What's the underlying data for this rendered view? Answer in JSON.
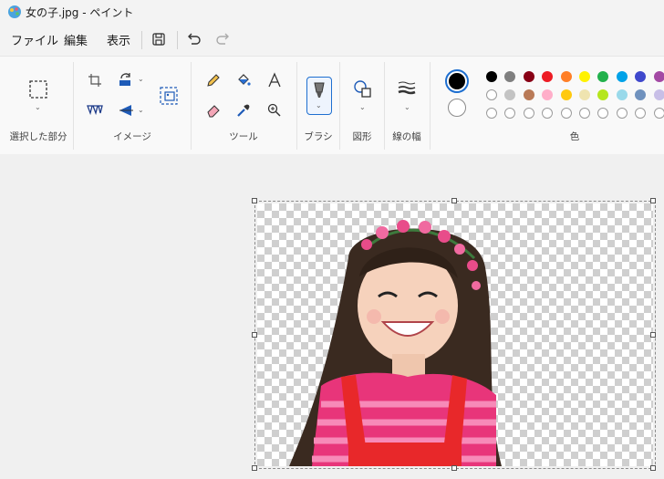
{
  "window": {
    "title": "女の子.jpg - ペイント"
  },
  "menu": {
    "file": "ファイル",
    "edit": "編集",
    "view": "表示"
  },
  "toolbar_icons": [
    "save-icon",
    "undo-icon",
    "redo-icon"
  ],
  "ribbon": {
    "groups": {
      "selection": "選択した部分",
      "image": "イメージ",
      "tools": "ツール",
      "brush": "ブラシ",
      "shapes": "図形",
      "size": "線の幅",
      "colors": "色"
    },
    "primary_color": "#000000",
    "secondary_color": "#ffffff",
    "palette_row1": [
      "#000000",
      "#7f7f7f",
      "#880015",
      "#ed1c24",
      "#ff7f27",
      "#fff200",
      "#22b14c",
      "#00a2e8",
      "#3f48cc",
      "#a349a4"
    ],
    "palette_row2": [
      "#ffffff",
      "#c3c3c3",
      "#b97a57",
      "#ffaec9",
      "#ffc90e",
      "#efe4b0",
      "#b5e61d",
      "#99d9ea",
      "#7092be",
      "#c8bfe7"
    ],
    "palette_row3_count": 10
  }
}
